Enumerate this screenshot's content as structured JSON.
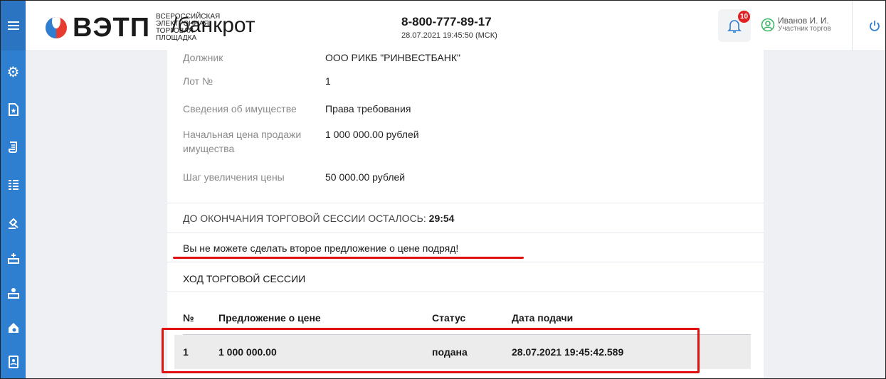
{
  "sidebar": {
    "menu_icon": "hamburger-icon",
    "items": [
      {
        "icon": "settings-gear-icon",
        "glyph": "⚙"
      },
      {
        "icon": "document-star-icon",
        "glyph": "🗎"
      },
      {
        "icon": "scroll-icon",
        "glyph": "📜"
      },
      {
        "icon": "list-icon",
        "glyph": "☰"
      },
      {
        "icon": "gavel-icon",
        "glyph": "⚖"
      },
      {
        "icon": "add-bid-icon",
        "glyph": "✚"
      },
      {
        "icon": "bid-icon",
        "glyph": "✎"
      },
      {
        "icon": "house-icon",
        "glyph": "⌂"
      },
      {
        "icon": "contacts-icon",
        "glyph": "☎"
      }
    ]
  },
  "header": {
    "logo_word": "ВЭТП",
    "logo_sub": "ВСЕРОССИЙСКАЯ ЭЛЕКТРОННАЯ ТОРГОВАЯ ПЛОЩАДКА",
    "section": "/банкрот",
    "phone": "8-800-777-89-17",
    "datetime": "28.07.2021 19:45:50 (МСК)",
    "notifications_count": "10",
    "user_name": "Иванов И. И.",
    "user_role": "Участник торгов",
    "colors": {
      "accent": "#2f7fd0",
      "logo_red": "#e63b2e",
      "badge": "#e02020",
      "user_icon": "#3fb56a"
    }
  },
  "lot": {
    "debtor_label": "Должник",
    "debtor_value": "ООО РИКБ \"РИНВЕСТБАНК\"",
    "lot_label": "Лот №",
    "lot_value": "1",
    "property_label": "Сведения об имуществе",
    "property_value": "Права требования",
    "start_price_label": "Начальная цена продажи имущества",
    "start_price_value": "1 000 000.00 рублей",
    "step_label": "Шаг увеличения цены",
    "step_value": "50 000.00 рублей"
  },
  "session": {
    "time_left_label": "ДО ОКОНЧАНИЯ ТОРГОВОЙ СЕССИИ ОСТАЛОСЬ:",
    "time_left_value": "29:54",
    "warning": "Вы не можете сделать второе предложение о цене подряд!",
    "progress_title": "ХОД ТОРГОВОЙ СЕССИИ"
  },
  "bids_table": {
    "columns": [
      "№",
      "Предложение о цене",
      "Статус",
      "Дата подачи"
    ],
    "rows": [
      {
        "num": "1",
        "price": "1 000 000.00",
        "status": "подана",
        "date": "28.07.2021 19:45:42.589"
      }
    ]
  }
}
